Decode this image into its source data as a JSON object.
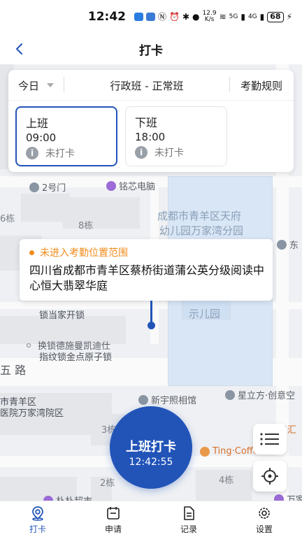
{
  "status_bar": {
    "time": "12:42",
    "net_speed_value": "12.9",
    "net_speed_unit": "K/s",
    "network": "5G",
    "network2": "4G",
    "battery": "68"
  },
  "header": {
    "title": "打卡"
  },
  "shift": {
    "today_label": "今日",
    "shift_name": "行政班 - 正常班",
    "rules_label": "考勤规则",
    "slots": [
      {
        "label": "上班",
        "time": "09:00",
        "status": "未打卡"
      },
      {
        "label": "下班",
        "time": "18:00",
        "status": "未打卡"
      }
    ]
  },
  "map": {
    "labels": {
      "gate": "2号门",
      "shop": "铭芯电脑",
      "b6": "6栋",
      "b8": "8栋",
      "kinder1": "成都市青羊区天府",
      "kinder2": "幼儿园万家湾分园",
      "east": "东",
      "kid_park": "示儿园",
      "lock1": "锁当家开锁",
      "lock2": "换锁德施曼凯迪仕",
      "lock3": "指纹锁金点原子锁",
      "road": "五 路",
      "hosp1": "市青羊区",
      "hosp2": "医院万家湾院区",
      "photo": "新宇照相馆",
      "star": "星立方·创意空",
      "b3": "3栋",
      "b2": "2栋",
      "b4": "4栋",
      "coffee": "Ting·Coffee",
      "market": "朴朴超市",
      "wanjia": "万家",
      "sanhui": "三汇"
    }
  },
  "location": {
    "status": "未进入考勤位置范围",
    "address": "四川省成都市青羊区蔡桥街道蒲公英分级阅读中心恒大翡翠华庭"
  },
  "punch": {
    "label": "上班打卡",
    "time": "12:42:55"
  },
  "bottom_nav": {
    "items": [
      {
        "label": "打卡",
        "icon": "punch-icon",
        "active": true
      },
      {
        "label": "申请",
        "icon": "apply-icon"
      },
      {
        "label": "记录",
        "icon": "record-icon"
      },
      {
        "label": "设置",
        "icon": "settings-icon"
      }
    ]
  },
  "colors": {
    "primary": "#2254b8",
    "warning": "#f08c1c",
    "muted": "#9aa0a8"
  }
}
